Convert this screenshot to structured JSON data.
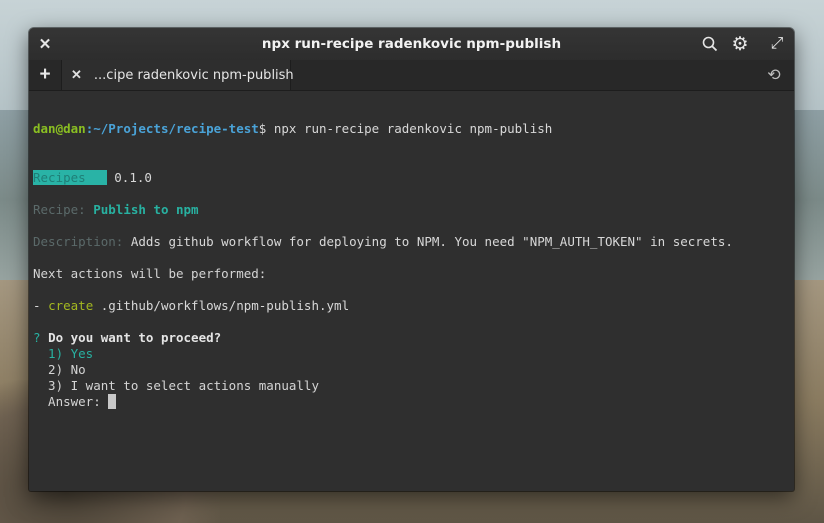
{
  "window": {
    "title": "npx run-recipe radenkovic npm-publish"
  },
  "icons": {
    "close": "✕",
    "search": "⌕",
    "settings": "⚙",
    "maximize": "⤢",
    "new_tab": "+",
    "history": "⟲"
  },
  "tabs": [
    {
      "label": "...cipe radenkovic npm-publish",
      "close": "✕"
    }
  ],
  "terminal": {
    "prompt": {
      "user_host": "dan@dan",
      "path": ":~/Projects/recipe-test",
      "symbol": "$",
      "command": " npx run-recipe radenkovic npm-publish"
    },
    "badge": {
      "label": "Recipes",
      "version": "0.1.0"
    },
    "recipe": {
      "key": "Recipe: ",
      "value": "Publish to npm"
    },
    "description": {
      "key": "Description: ",
      "value": "Adds github workflow for deploying to NPM. You need \"NPM_AUTH_TOKEN\" in secrets."
    },
    "next_actions": "Next actions will be performed:",
    "action": {
      "prefix": "- ",
      "verb": "create",
      "path": " .github/workflows/npm-publish.yml"
    },
    "question": {
      "mark": "? ",
      "text": "Do you want to proceed?"
    },
    "options": [
      "  1) Yes",
      "  2) No",
      "  3) I want to select actions manually"
    ],
    "answer_label": "  Answer: "
  },
  "colors": {
    "prompt_user": "#8abf22",
    "prompt_path": "#4aa3d8",
    "accent_teal": "#28b1a1",
    "create_verb": "#a4b820"
  }
}
